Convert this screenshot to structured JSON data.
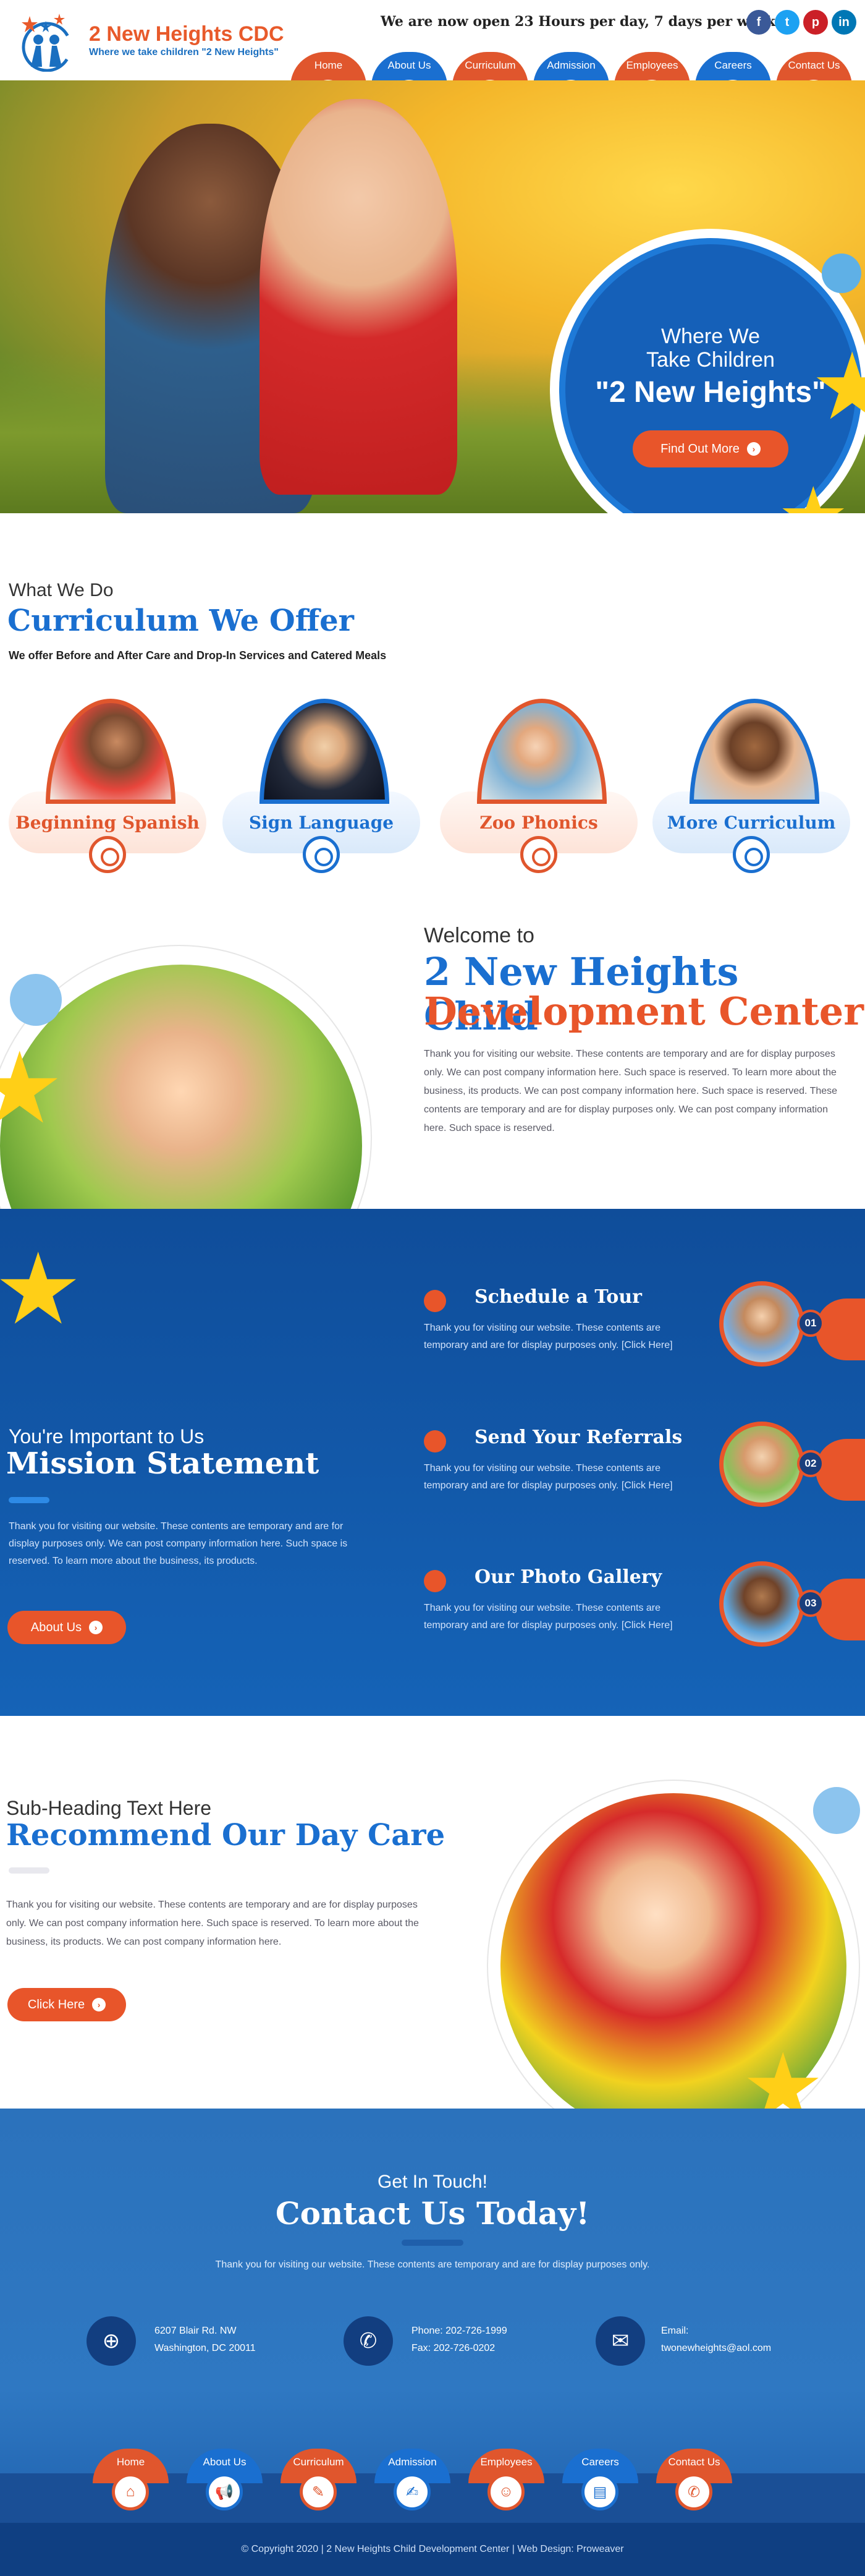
{
  "header": {
    "logo_title": "2 New Heights CDC",
    "logo_subtitle": "Where we take children \"2 New Heights\"",
    "hours": "We are now open 23 Hours per day, 7 days per week!",
    "social": [
      {
        "icon": "facebook-icon",
        "glyph": "f",
        "color": "#3b5998"
      },
      {
        "icon": "twitter-icon",
        "glyph": "t",
        "color": "#1da1f2"
      },
      {
        "icon": "pinterest-icon",
        "glyph": "p",
        "color": "#cb2027"
      },
      {
        "icon": "linkedin-icon",
        "glyph": "in",
        "color": "#0077b5"
      }
    ]
  },
  "nav": [
    {
      "label": "Home",
      "icon": "home-icon",
      "glyph": "⌂",
      "style": "orange"
    },
    {
      "label": "About Us",
      "icon": "megaphone-icon",
      "glyph": "📢",
      "style": "blue"
    },
    {
      "label": "Curriculum",
      "icon": "pencil-icon",
      "glyph": "✎",
      "style": "orange"
    },
    {
      "label": "Admission",
      "icon": "form-icon",
      "glyph": "✍",
      "style": "blue"
    },
    {
      "label": "Employees",
      "icon": "employee-badge-icon",
      "glyph": "☺",
      "style": "orange"
    },
    {
      "label": "Careers",
      "icon": "document-icon",
      "glyph": "▤",
      "style": "blue"
    },
    {
      "label": "Contact Us",
      "icon": "phone-icon",
      "glyph": "✆",
      "style": "orange"
    }
  ],
  "hero": {
    "line1": "Where We",
    "line2": "Take Children",
    "highlight": "\"2 New Heights\"",
    "button": "Find Out More"
  },
  "curriculum": {
    "kicker": "What We Do",
    "title": "Curriculum We Offer",
    "subtitle": "We offer Before and After Care and Drop-In Services and Catered Meals",
    "cards": [
      {
        "label": "Beginning Spanish",
        "theme": "orange"
      },
      {
        "label": "Sign Language",
        "theme": "blue"
      },
      {
        "label": "Zoo Phonics",
        "theme": "orange"
      },
      {
        "label": "More Curriculum",
        "theme": "blue"
      }
    ]
  },
  "welcome": {
    "kicker": "Welcome to",
    "title_line1": "2 New Heights Child",
    "title_line2": "Development Center",
    "body": "Thank you for visiting our website. These contents are temporary and are for display purposes only. We can post company information here. Such space is reserved. To learn more about the business, its products. We can post company information here. Such space is reserved. These contents are temporary and are for display purposes only. We can post company information here. Such space is reserved."
  },
  "mission": {
    "kicker": "You're Important to Us",
    "title": "Mission Statement",
    "body": "Thank you for visiting our website. These contents are temporary and are for display purposes only. We can post company information here. Such space is reserved. To learn more about the business, its products.",
    "button": "About Us",
    "features": [
      {
        "title": "Schedule a Tour",
        "text": "Thank you for visiting our website. These contents are temporary and are for display purposes only. [Click Here]",
        "num": "01"
      },
      {
        "title": "Send Your Referrals",
        "text": "Thank you for visiting our website. These contents are temporary and are for display purposes only. [Click Here]",
        "num": "02"
      },
      {
        "title": "Our Photo Gallery",
        "text": "Thank you for visiting our website. These contents are temporary and are for display purposes only. [Click Here]",
        "num": "03"
      }
    ]
  },
  "recommend": {
    "kicker": "Sub-Heading Text Here",
    "title": "Recommend Our Day Care",
    "body": "Thank you for visiting our website. These contents are temporary and are for display purposes only. We can post company information here. Such space is reserved. To learn more about the business, its products. We can post company information here.",
    "button": "Click Here"
  },
  "contact": {
    "kicker": "Get In Touch!",
    "title": "Contact Us Today!",
    "text": "Thank you for visiting our website. These contents are temporary and are for display purposes only.",
    "address_line1": "6207 Blair Rd. NW",
    "address_line2": "Washington, DC 20011",
    "phone": "Phone: 202-726-1999",
    "fax": "Fax: 202-726-0202",
    "email_label": "Email:",
    "email": "twonewheights@aol.com"
  },
  "footer": {
    "copyright": "© Copyright 2020 | 2 New Heights Child Development Center | Web Design: Proweaver"
  }
}
